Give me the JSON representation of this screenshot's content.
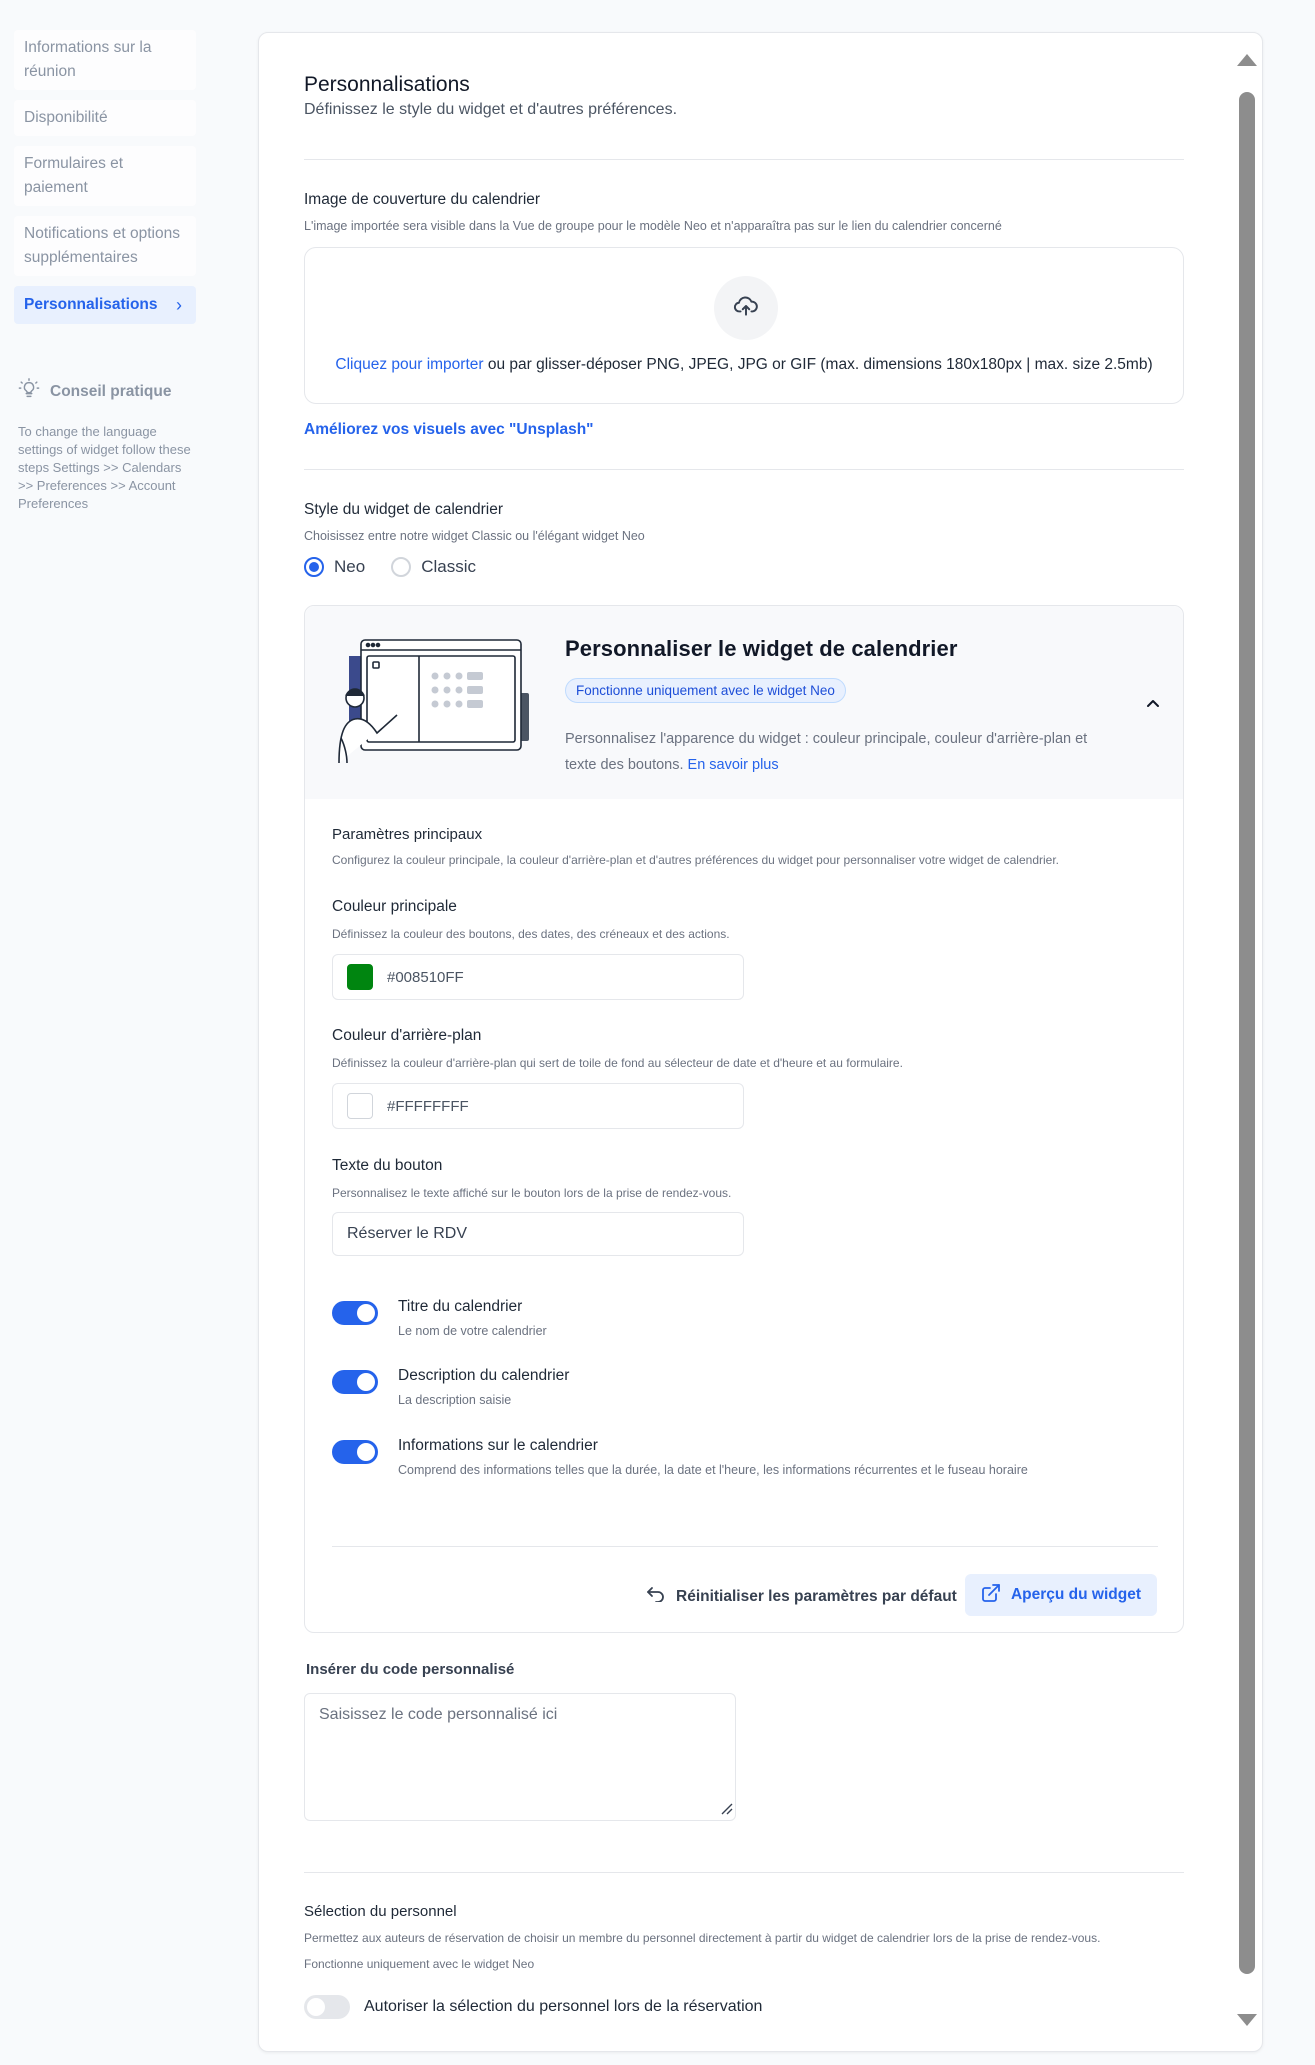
{
  "sidebar": {
    "items": [
      {
        "label": "Informations sur la réunion"
      },
      {
        "label": "Disponibilité"
      },
      {
        "label": "Formulaires et paiement"
      },
      {
        "label": "Notifications et options supplémentaires"
      },
      {
        "label": "Personnalisations"
      }
    ],
    "tip_title": "Conseil pratique",
    "tip_body": "To change the language settings of widget follow these steps Settings >> Calendars >> Preferences >> Account Preferences"
  },
  "header": {
    "title": "Personnalisations",
    "subtitle": "Définissez le style du widget et d'autres préférences."
  },
  "cover": {
    "label": "Image de couverture du calendrier",
    "hint": "L'image importée sera visible dans la Vue de groupe pour le modèle Neo et n'apparaîtra pas sur le lien du calendrier concerné",
    "upload_link": "Cliquez pour importer",
    "upload_rest": " ou par glisser-déposer PNG, JPEG, JPG or GIF (max. dimensions 180x180px | max. size 2.5mb)",
    "unsplash": "Améliorez vos visuels avec \"Unsplash\""
  },
  "style": {
    "label": "Style du widget de calendrier",
    "hint": "Choisissez entre notre widget Classic ou l'élégant widget Neo",
    "options": [
      "Neo",
      "Classic"
    ],
    "selected": "Neo"
  },
  "widget": {
    "title": "Personnaliser le widget de calendrier",
    "badge": "Fonctionne uniquement avec le widget Neo",
    "desc": "Personnalisez l'apparence du widget : couleur principale, couleur d'arrière-plan et texte des boutons. ",
    "learn_more": "En savoir plus",
    "main_title": "Paramètres principaux",
    "main_hint": "Configurez la couleur principale, la couleur d'arrière-plan et d'autres préférences du widget pour personnaliser votre widget de calendrier.",
    "primary_label": "Couleur principale",
    "primary_hint": "Définissez la couleur des boutons, des dates, des créneaux et des actions.",
    "primary_value": "#008510FF",
    "primary_color": "#008510",
    "bg_label": "Couleur d'arrière-plan",
    "bg_hint": "Définissez la couleur d'arrière-plan qui sert de toile de fond au sélecteur de date et d'heure et au formulaire.",
    "bg_value": "#FFFFFFFF",
    "bg_color": "#FFFFFF",
    "btn_label": "Texte du bouton",
    "btn_hint": "Personnalisez le texte affiché sur le bouton lors de la prise de rendez-vous.",
    "btn_value": "Réserver le RDV",
    "toggles": [
      {
        "label": "Titre du calendrier",
        "sub": "Le nom de votre calendrier",
        "on": true
      },
      {
        "label": "Description du calendrier",
        "sub": "La description saisie",
        "on": true
      },
      {
        "label": "Informations sur le calendrier",
        "sub": "Comprend des informations telles que la durée, la date et l'heure, les informations récurrentes et le fuseau horaire",
        "on": true
      }
    ],
    "reset": "Réinitialiser les paramètres par défaut",
    "preview": "Aperçu du widget"
  },
  "code": {
    "label": "Insérer du code personnalisé",
    "placeholder": "Saisissez le code personnalisé ici"
  },
  "staff": {
    "label": "Sélection du personnel",
    "hint1": "Permettez aux auteurs de réservation de choisir un membre du personnel directement à partir du widget de calendrier lors de la prise de rendez-vous.",
    "hint2": "Fonctionne uniquement avec le widget Neo",
    "toggle_label": "Autoriser la sélection du personnel lors de la réservation",
    "toggle_on": false
  },
  "colors": {
    "accent": "#2563eb",
    "primary_swatch": "#008510"
  }
}
